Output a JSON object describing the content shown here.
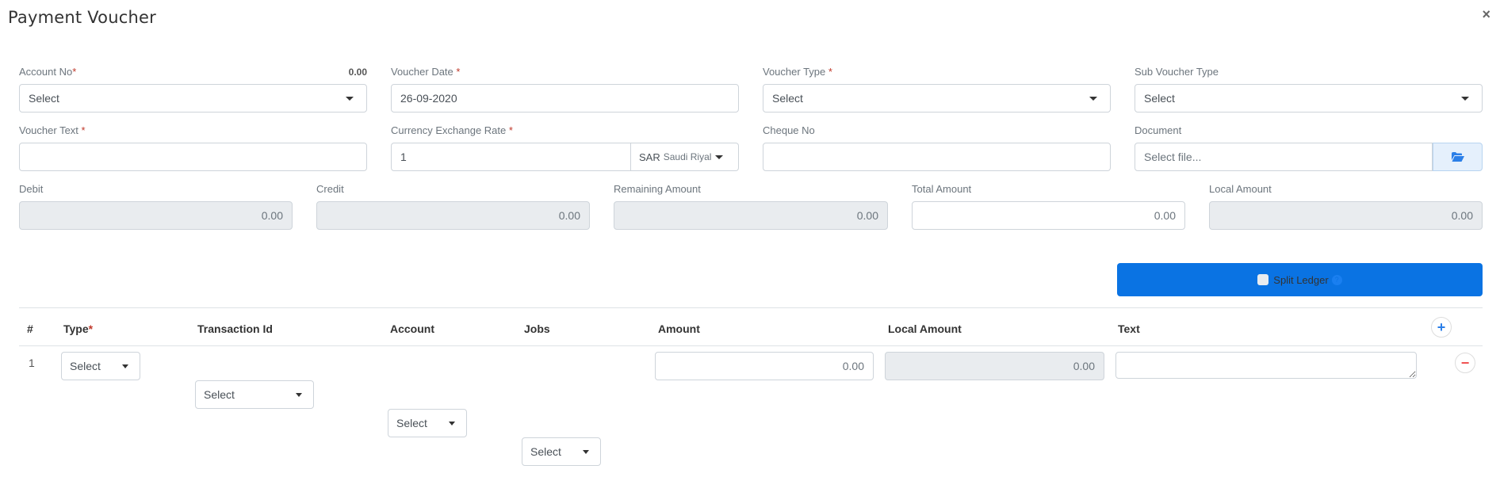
{
  "modal": {
    "title": "Payment Voucher",
    "close_label": "×"
  },
  "form": {
    "account_no": {
      "label": "Account No",
      "required": "*",
      "balance": "0.00",
      "value": "Select"
    },
    "voucher_date": {
      "label": "Voucher Date ",
      "required": "*",
      "value": "26-09-2020"
    },
    "voucher_type": {
      "label": "Voucher Type ",
      "required": "*",
      "value": "Select"
    },
    "sub_voucher_type": {
      "label": "Sub Voucher Type",
      "value": "Select"
    },
    "voucher_text": {
      "label": "Voucher Text ",
      "required": "*",
      "value": ""
    },
    "currency_exchange_rate": {
      "label": "Currency Exchange Rate ",
      "required": "*",
      "value": "1",
      "currency_code": "SAR",
      "currency_name": "Saudi Riyal"
    },
    "cheque_no": {
      "label": "Cheque No",
      "value": ""
    },
    "document": {
      "label": "Document",
      "placeholder": "Select file..."
    },
    "debit": {
      "label": "Debit",
      "value": "0.00"
    },
    "credit": {
      "label": "Credit",
      "value": "0.00"
    },
    "remaining_amount": {
      "label": "Remaining Amount",
      "value": "0.00"
    },
    "total_amount": {
      "label": "Total Amount",
      "value": "0.00"
    },
    "local_amount": {
      "label": "Local Amount",
      "value": "0.00"
    }
  },
  "split_ledger": {
    "label": "Split Ledger",
    "checked": false,
    "help": "?"
  },
  "ledger_table": {
    "columns": [
      "#",
      "Type",
      "Transaction Id",
      "Account",
      "Jobs",
      "Amount",
      "Local Amount",
      "Text"
    ],
    "type_required": "*",
    "rows": [
      {
        "index": "1",
        "type": "Select",
        "transaction_id": "Select",
        "account": "Select",
        "jobs": "Select",
        "amount": "0.00",
        "local_amount": "0.00",
        "text": ""
      }
    ],
    "add_label": "+",
    "remove_label": "−"
  },
  "colors": {
    "primary": "#0a73e3",
    "required": "#c0392b",
    "remove": "#f05050",
    "add": "#2b7fe8"
  }
}
